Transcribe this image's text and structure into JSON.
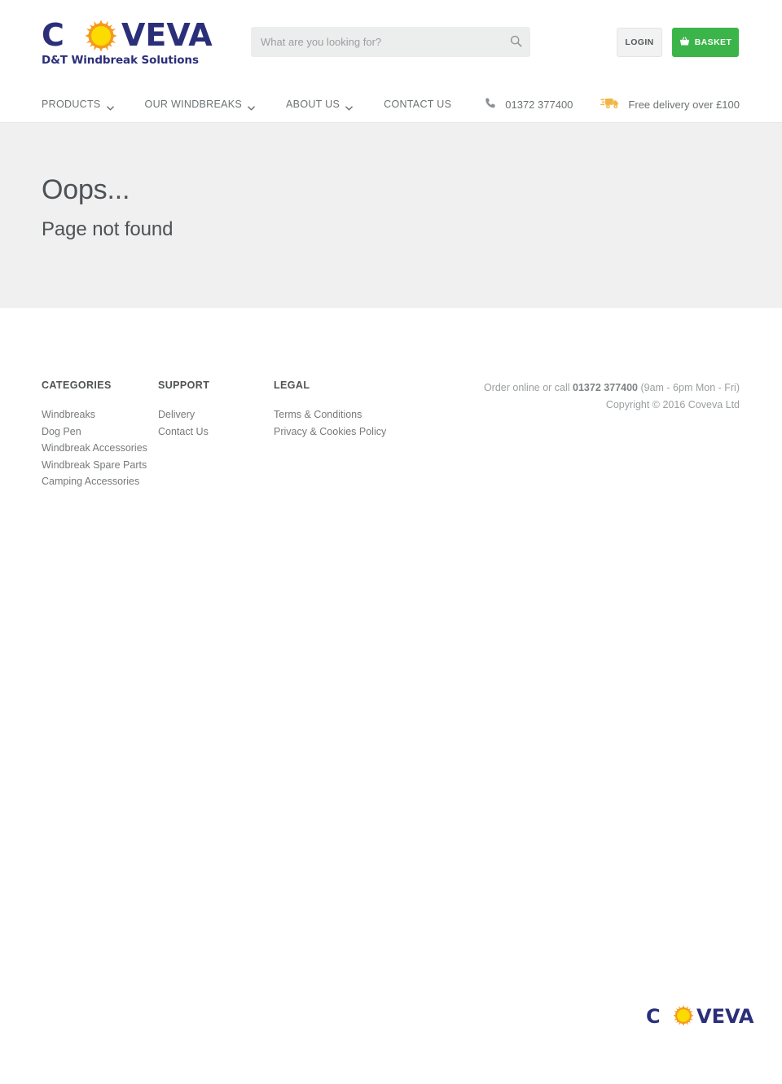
{
  "brand": {
    "logo_c": "C",
    "logo_rest": "VEVA",
    "sun_icon": "sun-icon",
    "tagline": "D&T Windbreak Solutions",
    "navy": "#2b2f7a",
    "sun_orange": "#f39b2b",
    "sun_yellow": "#fcdc00"
  },
  "search": {
    "placeholder": "What are you looking for?",
    "value": "",
    "icon": "search-icon"
  },
  "header": {
    "login_label": "LOGIN",
    "basket_label": "BASKET",
    "basket_icon": "basket-icon",
    "basket_color": "#3bb54a"
  },
  "nav": {
    "items": [
      {
        "label": "PRODUCTS",
        "has_caret": true
      },
      {
        "label": "OUR WINDBREAKS",
        "has_caret": true
      },
      {
        "label": "ABOUT US",
        "has_caret": true
      },
      {
        "label": "CONTACT US",
        "has_caret": false
      }
    ],
    "phone": {
      "icon": "phone-icon",
      "label": "01372 377400"
    },
    "delivery": {
      "icon": "truck-icon",
      "label": "Free delivery over £100"
    }
  },
  "hero": {
    "title": "Oops...",
    "subtitle": "Page not found",
    "background": "#f0f0f0"
  },
  "footer": {
    "columns": [
      {
        "heading": "CATEGORIES",
        "links": [
          "Windbreaks",
          "Dog Pen",
          "Windbreak Accessories",
          "Windbreak Spare Parts",
          "Camping Accessories"
        ]
      },
      {
        "heading": "SUPPORT",
        "links": [
          "Delivery",
          "Contact Us"
        ]
      },
      {
        "heading": "LEGAL",
        "links": [
          "Terms & Conditions",
          "Privacy & Cookies Policy"
        ]
      }
    ],
    "order_prefix": "Order online or call ",
    "order_phone": "01372 377400",
    "order_suffix": " (9am - 6pm Mon - Fri)",
    "copyright": "Copyright © 2016 Coveva Ltd",
    "logo_c": "C",
    "logo_rest": "VEVA"
  }
}
